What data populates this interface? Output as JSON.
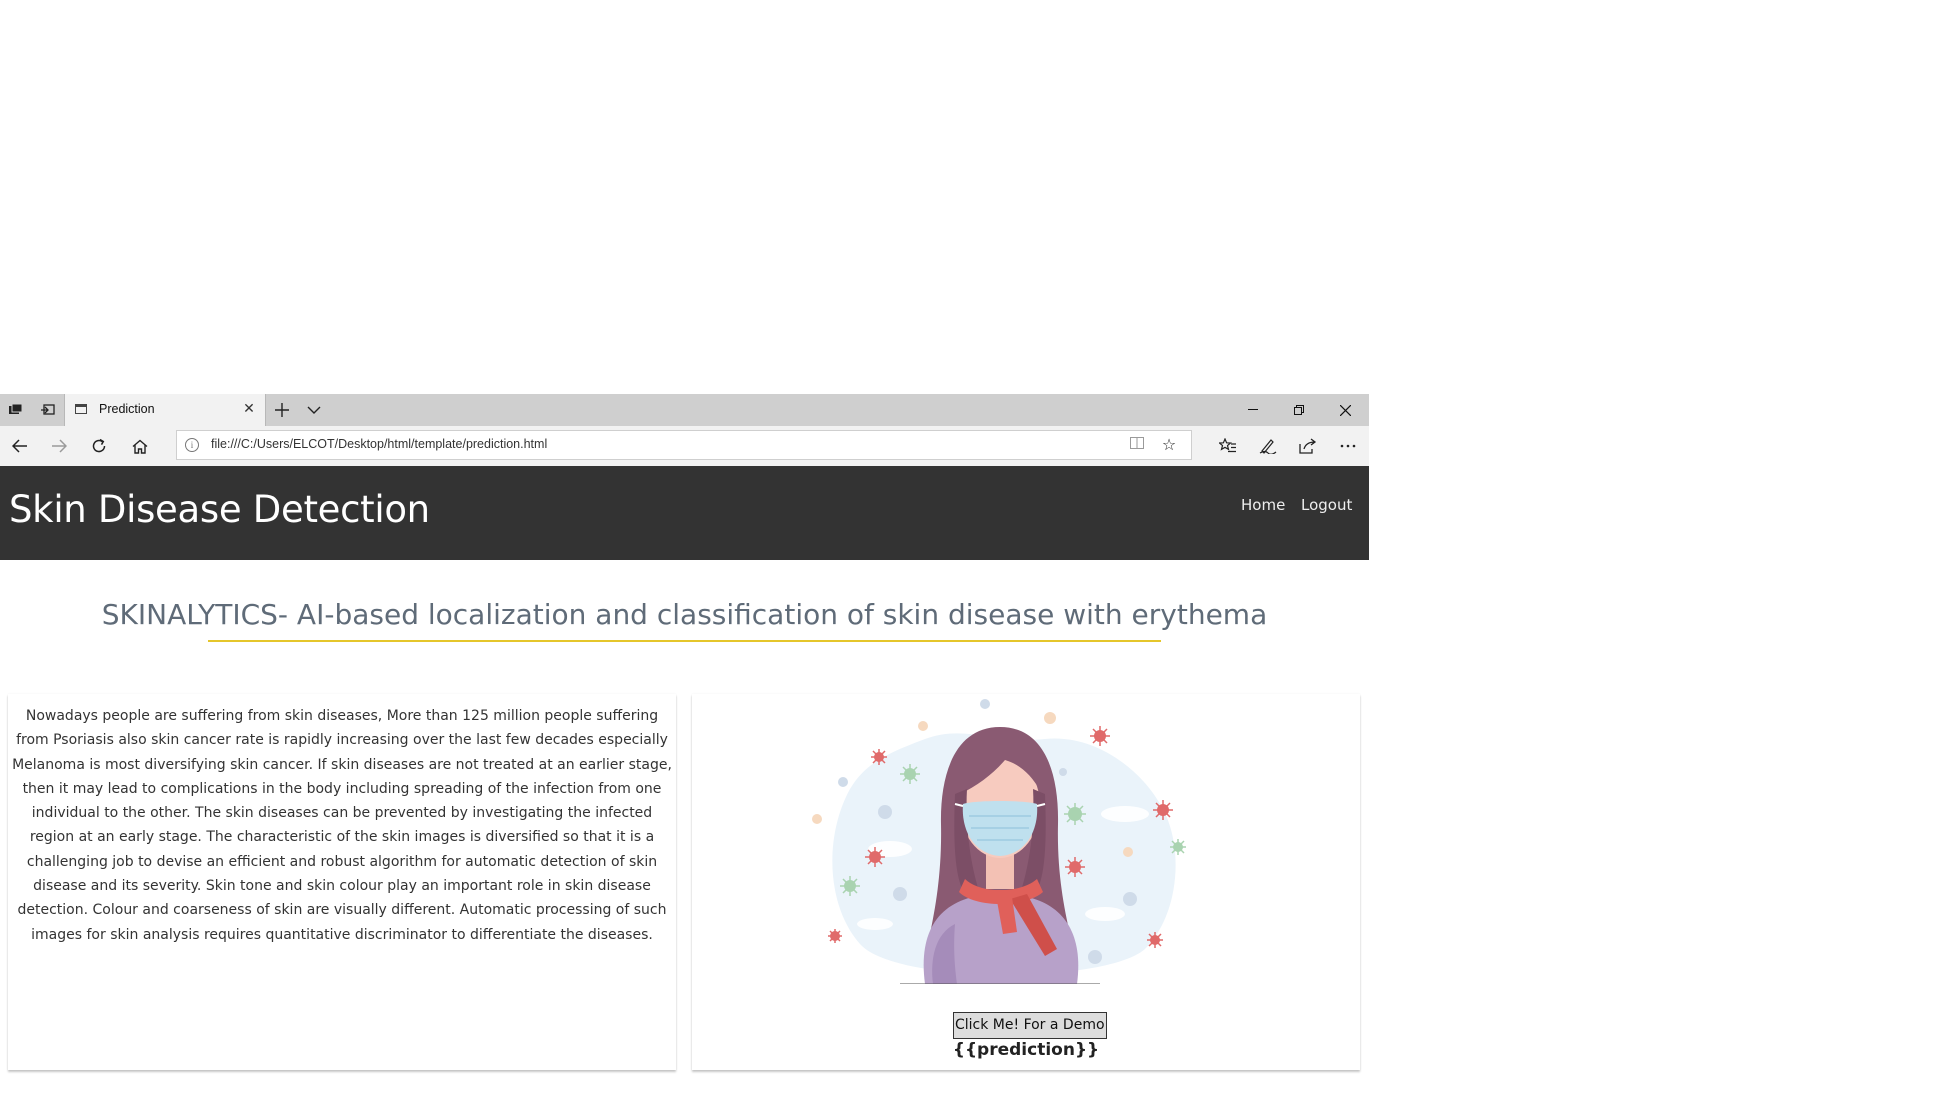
{
  "browser": {
    "tab": {
      "title": "Prediction"
    },
    "address": {
      "url": "file:///C:/Users/ELCOT/Desktop/html/template/prediction.html"
    }
  },
  "site": {
    "title": "Skin Disease Detection",
    "nav": {
      "home": "Home",
      "logout": "Logout"
    }
  },
  "page": {
    "headline": "SKINALYTICS- AI-based localization and classification of skin disease with erythema",
    "description": "Nowadays people are suffering from skin diseases, More than 125 million people suffering from Psoriasis also skin cancer rate is rapidly increasing over the last few decades especially Melanoma is most diversifying skin cancer. If skin diseases are not treated at an earlier stage, then it may lead to complications in the body including spreading of the infection from one individual to the other. The skin diseases can be prevented by investigating the infected region at an early stage. The characteristic of the skin images is diversified so that it is a challenging job to devise an efficient and robust algorithm for automatic detection of skin disease and its severity. Skin tone and skin colour play an important role in skin disease detection. Colour and coarseness of skin are visually different. Automatic processing of such images for skin analysis requires quantitative discriminator to differentiate the diseases.",
    "demo_button": "Click Me! For a Demo",
    "prediction": "{{prediction}}"
  },
  "colors": {
    "header_bg": "#333333",
    "headline": "#5f6b78",
    "accent_rule": "#e5c62b",
    "scarf": "#e0605a",
    "mask": "#bfe0ee",
    "hair": "#8a5a72",
    "sweater": "#b7a1c9"
  }
}
